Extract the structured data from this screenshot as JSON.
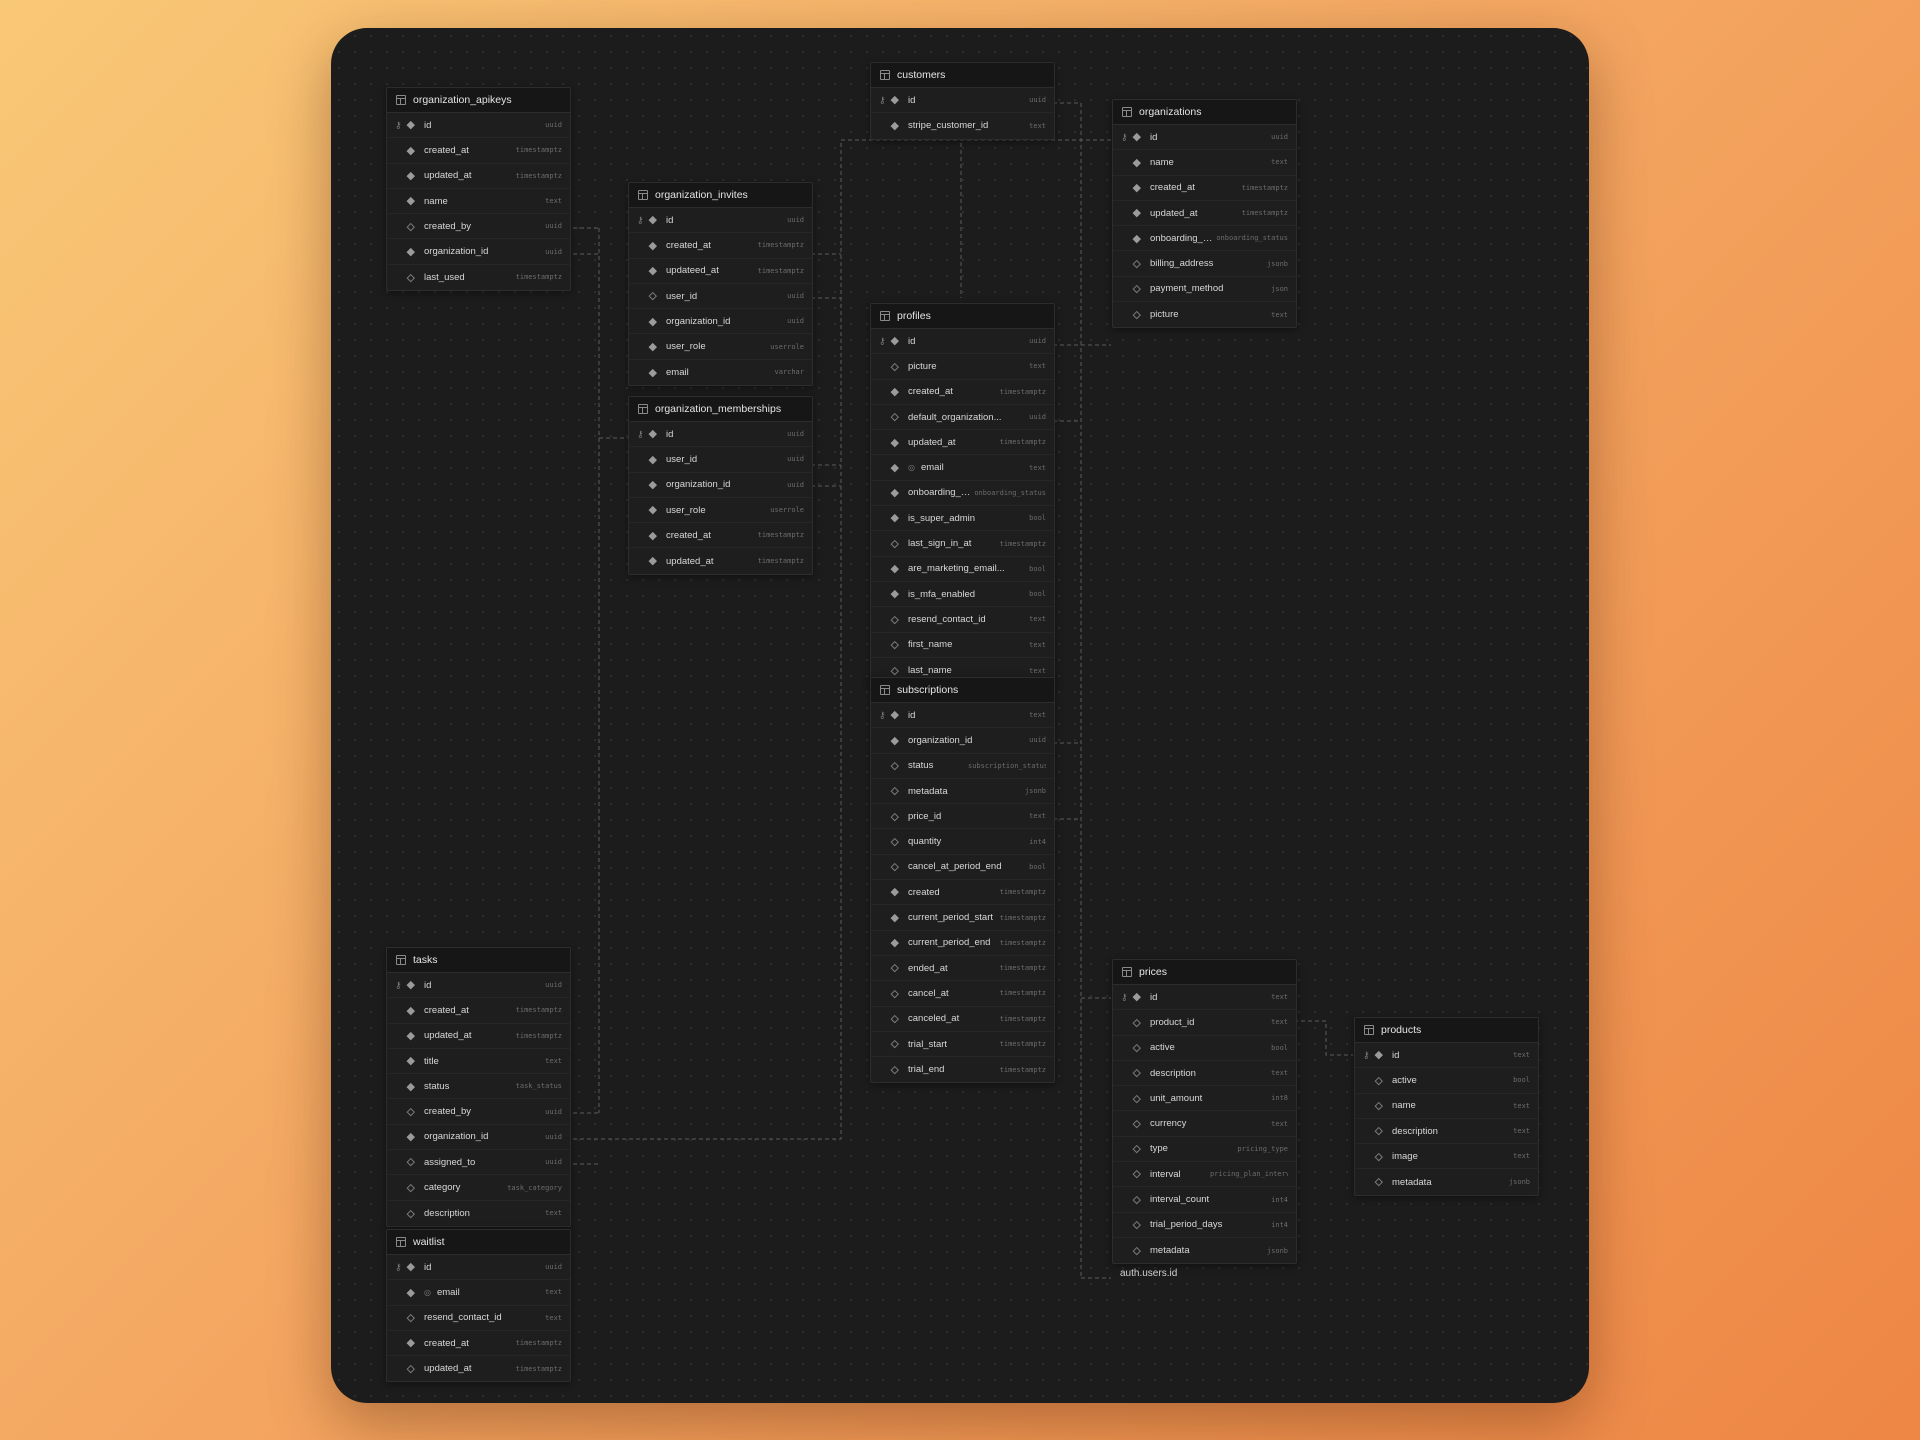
{
  "tables": [
    {
      "id": "organization_apikeys",
      "name": "organization_apikeys",
      "columns": [
        {
          "name": "id",
          "type": "uuid",
          "pk": true,
          "required": true
        },
        {
          "name": "created_at",
          "type": "timestamptz",
          "required": true
        },
        {
          "name": "updated_at",
          "type": "timestamptz",
          "required": true
        },
        {
          "name": "name",
          "type": "text",
          "required": true
        },
        {
          "name": "created_by",
          "type": "uuid",
          "required": false
        },
        {
          "name": "organization_id",
          "type": "uuid",
          "required": true
        },
        {
          "name": "last_used",
          "type": "timestamptz",
          "required": false
        }
      ]
    },
    {
      "id": "organization_invites",
      "name": "organization_invites",
      "columns": [
        {
          "name": "id",
          "type": "uuid",
          "pk": true,
          "required": true
        },
        {
          "name": "created_at",
          "type": "timestamptz",
          "required": true
        },
        {
          "name": "updateed_at",
          "type": "timestamptz",
          "required": true
        },
        {
          "name": "user_id",
          "type": "uuid",
          "required": false
        },
        {
          "name": "organization_id",
          "type": "uuid",
          "required": true
        },
        {
          "name": "user_role",
          "type": "userrole",
          "required": true
        },
        {
          "name": "email",
          "type": "varchar",
          "required": true
        }
      ]
    },
    {
      "id": "organization_memberships",
      "name": "organization_memberships",
      "columns": [
        {
          "name": "id",
          "type": "uuid",
          "pk": true,
          "required": true
        },
        {
          "name": "user_id",
          "type": "uuid",
          "required": true
        },
        {
          "name": "organization_id",
          "type": "uuid",
          "required": true
        },
        {
          "name": "user_role",
          "type": "userrole",
          "required": true
        },
        {
          "name": "created_at",
          "type": "timestamptz",
          "required": true
        },
        {
          "name": "updated_at",
          "type": "timestamptz",
          "required": true
        }
      ]
    },
    {
      "id": "customers",
      "name": "customers",
      "columns": [
        {
          "name": "id",
          "type": "uuid",
          "pk": true,
          "required": true
        },
        {
          "name": "stripe_customer_id",
          "type": "text",
          "required": true
        }
      ]
    },
    {
      "id": "organizations",
      "name": "organizations",
      "columns": [
        {
          "name": "id",
          "type": "uuid",
          "pk": true,
          "required": true
        },
        {
          "name": "name",
          "type": "text",
          "required": true
        },
        {
          "name": "created_at",
          "type": "timestamptz",
          "required": true
        },
        {
          "name": "updated_at",
          "type": "timestamptz",
          "required": true
        },
        {
          "name": "onboarding_status",
          "type": "onboarding_status",
          "required": true
        },
        {
          "name": "billing_address",
          "type": "jsonb",
          "required": false
        },
        {
          "name": "payment_method",
          "type": "json",
          "required": false
        },
        {
          "name": "picture",
          "type": "text",
          "required": false
        }
      ]
    },
    {
      "id": "profiles",
      "name": "profiles",
      "columns": [
        {
          "name": "id",
          "type": "uuid",
          "pk": true,
          "required": true
        },
        {
          "name": "picture",
          "type": "text",
          "required": false
        },
        {
          "name": "created_at",
          "type": "timestamptz",
          "required": true
        },
        {
          "name": "default_organization...",
          "type": "uuid",
          "required": false
        },
        {
          "name": "updated_at",
          "type": "timestamptz",
          "required": true
        },
        {
          "name": "email",
          "type": "text",
          "required": true,
          "unique": true
        },
        {
          "name": "onboarding_status",
          "type": "onboarding_status",
          "required": true
        },
        {
          "name": "is_super_admin",
          "type": "bool",
          "required": true
        },
        {
          "name": "last_sign_in_at",
          "type": "timestamptz",
          "required": false
        },
        {
          "name": "are_marketing_email...",
          "type": "bool",
          "required": true
        },
        {
          "name": "is_mfa_enabled",
          "type": "bool",
          "required": true
        },
        {
          "name": "resend_contact_id",
          "type": "text",
          "required": false
        },
        {
          "name": "first_name",
          "type": "text",
          "required": false
        },
        {
          "name": "last_name",
          "type": "text",
          "required": false
        }
      ]
    },
    {
      "id": "subscriptions",
      "name": "subscriptions",
      "columns": [
        {
          "name": "id",
          "type": "text",
          "pk": true,
          "required": true
        },
        {
          "name": "organization_id",
          "type": "uuid",
          "required": true
        },
        {
          "name": "status",
          "type": "subscription_status",
          "required": false
        },
        {
          "name": "metadata",
          "type": "jsonb",
          "required": false
        },
        {
          "name": "price_id",
          "type": "text",
          "required": false
        },
        {
          "name": "quantity",
          "type": "int4",
          "required": false
        },
        {
          "name": "cancel_at_period_end",
          "type": "bool",
          "required": false
        },
        {
          "name": "created",
          "type": "timestamptz",
          "required": true
        },
        {
          "name": "current_period_start",
          "type": "timestamptz",
          "required": true
        },
        {
          "name": "current_period_end",
          "type": "timestamptz",
          "required": true
        },
        {
          "name": "ended_at",
          "type": "timestamptz",
          "required": false
        },
        {
          "name": "cancel_at",
          "type": "timestamptz",
          "required": false
        },
        {
          "name": "canceled_at",
          "type": "timestamptz",
          "required": false
        },
        {
          "name": "trial_start",
          "type": "timestamptz",
          "required": false
        },
        {
          "name": "trial_end",
          "type": "timestamptz",
          "required": false
        }
      ]
    },
    {
      "id": "prices",
      "name": "prices",
      "columns": [
        {
          "name": "id",
          "type": "text",
          "pk": true,
          "required": true
        },
        {
          "name": "product_id",
          "type": "text",
          "required": false
        },
        {
          "name": "active",
          "type": "bool",
          "required": false
        },
        {
          "name": "description",
          "type": "text",
          "required": false
        },
        {
          "name": "unit_amount",
          "type": "int8",
          "required": false
        },
        {
          "name": "currency",
          "type": "text",
          "required": false
        },
        {
          "name": "type",
          "type": "pricing_type",
          "required": false
        },
        {
          "name": "interval",
          "type": "pricing_plan_interval",
          "required": false
        },
        {
          "name": "interval_count",
          "type": "int4",
          "required": false
        },
        {
          "name": "trial_period_days",
          "type": "int4",
          "required": false
        },
        {
          "name": "metadata",
          "type": "jsonb",
          "required": false
        }
      ]
    },
    {
      "id": "products",
      "name": "products",
      "columns": [
        {
          "name": "id",
          "type": "text",
          "pk": true,
          "required": true
        },
        {
          "name": "active",
          "type": "bool",
          "required": false
        },
        {
          "name": "name",
          "type": "text",
          "required": false
        },
        {
          "name": "description",
          "type": "text",
          "required": false
        },
        {
          "name": "image",
          "type": "text",
          "required": false
        },
        {
          "name": "metadata",
          "type": "jsonb",
          "required": false
        }
      ]
    },
    {
      "id": "tasks",
      "name": "tasks",
      "columns": [
        {
          "name": "id",
          "type": "uuid",
          "pk": true,
          "required": true
        },
        {
          "name": "created_at",
          "type": "timestamptz",
          "required": true
        },
        {
          "name": "updated_at",
          "type": "timestamptz",
          "required": true
        },
        {
          "name": "title",
          "type": "text",
          "required": true
        },
        {
          "name": "status",
          "type": "task_status",
          "required": true
        },
        {
          "name": "created_by",
          "type": "uuid",
          "required": false
        },
        {
          "name": "organization_id",
          "type": "uuid",
          "required": true
        },
        {
          "name": "assigned_to",
          "type": "uuid",
          "required": false
        },
        {
          "name": "category",
          "type": "task_category",
          "required": false
        },
        {
          "name": "description",
          "type": "text",
          "required": false
        }
      ]
    },
    {
      "id": "waitlist",
      "name": "waitlist",
      "columns": [
        {
          "name": "id",
          "type": "uuid",
          "pk": true,
          "required": true
        },
        {
          "name": "email",
          "type": "text",
          "required": true,
          "unique": true
        },
        {
          "name": "resend_contact_id",
          "type": "text",
          "required": false
        },
        {
          "name": "created_at",
          "type": "timestamptz",
          "required": true
        },
        {
          "name": "updated_at",
          "type": "timestamptz",
          "required": false
        }
      ]
    }
  ],
  "external_ref": {
    "label": "auth.users.id"
  },
  "colors": {
    "background": "#1c1c1c",
    "table_bg": "#1e1e1e",
    "header_bg": "#161616",
    "line": "#5c5c5c",
    "text": "#d8d8d8",
    "type_text": "#6c6c6c"
  }
}
